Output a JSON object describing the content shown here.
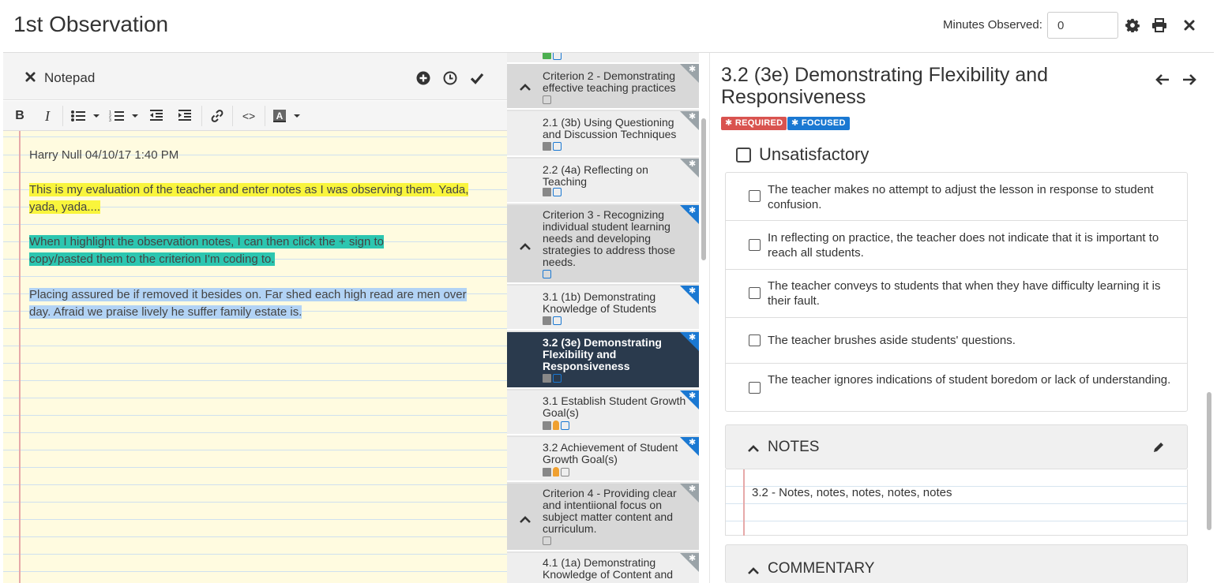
{
  "header": {
    "title": "1st Observation",
    "minutes_label": "Minutes Observed:",
    "minutes_value": "0"
  },
  "notepad": {
    "title": "Notepad",
    "author_line": "Harry Null 04/10/17 1:40 PM",
    "para1_line1": "This is my evaluation of the teacher and enter notes as I was observing them.  Yada,",
    "para1_line2": "yada, yada....",
    "para2_line1": "When I highlight the observation notes, I can then click the + sign to",
    "para2_line2": "copy/pasted them to the criterion I'm coding to.",
    "para3_line1": "Placing assured be if removed it besides on. Far shed each high read are men over",
    "para3_line2": "day. Afraid we praise lively he suffer family estate is.",
    "toolbar": {
      "bold": "B",
      "italic": "I",
      "code": "<>",
      "font_color": "A"
    }
  },
  "criteria": [
    {
      "label": "Criterion 2 - Demonstrating effective teaching practices",
      "group": true
    },
    {
      "label": "2.1 (3b) Using Questioning and Discussion Techniques"
    },
    {
      "label": "2.2 (4a) Reflecting on Teaching"
    },
    {
      "label": "Criterion 3 - Recognizing individual student learning needs and developing strategies to address those needs.",
      "group": true
    },
    {
      "label": "3.1 (1b) Demonstrating Knowledge of Students"
    },
    {
      "label": "3.2 (3e) Demonstrating Flexibility and Responsiveness",
      "active": true
    },
    {
      "label": "3.1 Establish Student Growth Goal(s)"
    },
    {
      "label": "3.2 Achievement of Student Growth Goal(s)"
    },
    {
      "label": "Criterion 4 - Providing clear and intentiional focus on subject matter content and curriculum.",
      "group": true
    },
    {
      "label": "4.1 (1a) Demonstrating Knowledge of Content and"
    }
  ],
  "detail": {
    "title": "3.2 (3e) Demonstrating Flexibility and Responsiveness",
    "tag_required": "REQUIRED",
    "tag_focused": "FOCUSED",
    "level": "Unsatisfactory",
    "indicators": [
      "The teacher makes no attempt to adjust the lesson in response to student confusion.",
      "In reflecting on practice, the teacher does not indicate that it is important to reach all students.",
      "The teacher conveys to students that when they have difficulty learning it is their fault.",
      "The teacher brushes aside students' questions.",
      "The teacher ignores indications of student boredom or lack of understanding."
    ],
    "notes_title": "NOTES",
    "notes_text": "3.2 - Notes, notes, notes, notes, notes",
    "commentary_title": "COMMENTARY"
  },
  "colors": {
    "active_item": "#2a3a4d",
    "required": "#d9534f",
    "focused": "#1a78d2",
    "highlight_yellow": "#f9f53c",
    "highlight_teal": "#2cc6b0",
    "highlight_blue": "#b2d3f5"
  }
}
